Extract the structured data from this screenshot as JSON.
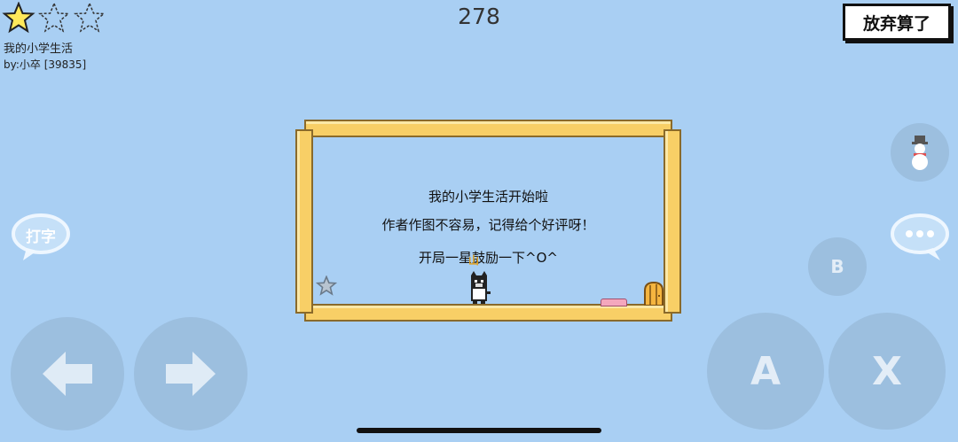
{
  "hud": {
    "stars_earned": 1,
    "stars_total": 3,
    "level_name": "我的小学生活",
    "author": "by:小卒 [39835]",
    "score": "278",
    "give_up_label": "放弃算了"
  },
  "dialog": {
    "line1": "我的小学生活开始啦",
    "line2": "作者作图不容易，记得给个好评呀！",
    "line3": "开局一星鼓励一下^O^"
  },
  "character": {
    "name_tag": "山"
  },
  "controls": {
    "chat_label": "打字",
    "b_label": "B",
    "a_label": "A",
    "x_label": "X"
  },
  "colors": {
    "background": "#a9cff3",
    "frame": "#f8cf66",
    "star": "#ffe95a"
  }
}
